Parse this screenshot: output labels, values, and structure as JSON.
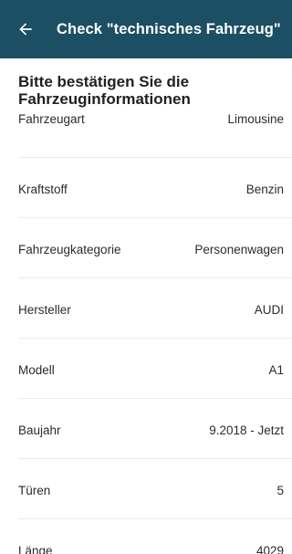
{
  "appbar": {
    "title": "Check \"technisches Fahrzeug\"",
    "back_icon": "arrow-left-icon",
    "background": "#1c4f63"
  },
  "heading": "Bitte bestätigen Sie die Fahrzeuginformationen",
  "fields": [
    {
      "label": "Fahrzeugart",
      "value": "Limousine"
    },
    {
      "label": "Kraftstoff",
      "value": "Benzin"
    },
    {
      "label": "Fahrzeugkategorie",
      "value": "Personenwagen"
    },
    {
      "label": "Hersteller",
      "value": "AUDI"
    },
    {
      "label": "Modell",
      "value": "A1"
    },
    {
      "label": "Baujahr",
      "value": "9.2018 - Jetzt"
    },
    {
      "label": "Türen",
      "value": "5"
    },
    {
      "label": "Länge",
      "value": "4029"
    }
  ]
}
